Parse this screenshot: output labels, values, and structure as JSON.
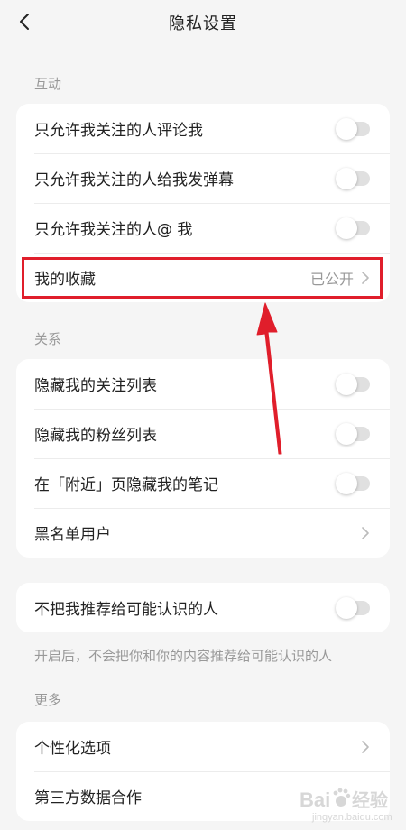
{
  "header": {
    "title": "隐私设置",
    "back_icon": "back-arrow-icon"
  },
  "sections": {
    "interaction": {
      "label": "互动",
      "items": [
        {
          "label": "只允许我关注的人评论我",
          "toggle": false
        },
        {
          "label": "只允许我关注的人给我发弹幕",
          "toggle": false
        },
        {
          "label": "只允许我关注的人@ 我",
          "toggle": false
        },
        {
          "label": "我的收藏",
          "value": "已公开"
        }
      ]
    },
    "relations": {
      "label": "关系",
      "items": [
        {
          "label": "隐藏我的关注列表",
          "toggle": false
        },
        {
          "label": "隐藏我的粉丝列表",
          "toggle": false
        },
        {
          "label": "在「附近」页隐藏我的笔记",
          "toggle": false
        },
        {
          "label": "黑名单用户"
        }
      ]
    },
    "recommend": {
      "items": [
        {
          "label": "不把我推荐给可能认识的人",
          "toggle": false
        }
      ],
      "hint": "开启后，不会把你和你的内容推荐给可能认识的人"
    },
    "more": {
      "label": "更多",
      "items": [
        {
          "label": "个性化选项"
        },
        {
          "label": "第三方数据合作"
        }
      ]
    }
  },
  "watermark": {
    "text_logo": "Baidu 经验",
    "sub": "jingyan.baidu.com"
  },
  "colors": {
    "highlight": "#e01e2b",
    "toggle_off": "#e0e0e0",
    "secondary_text": "#999999"
  }
}
